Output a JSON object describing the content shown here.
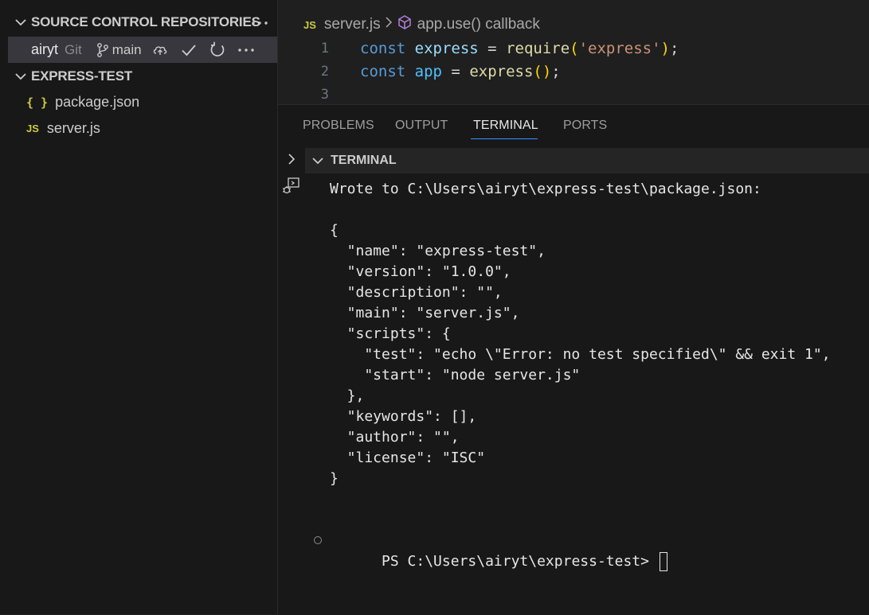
{
  "sidebar": {
    "scm_title": "SOURCE CONTROL REPOSITORIES",
    "repo": {
      "name": "airyt",
      "provider": "Git",
      "branch": "main"
    },
    "folder_title": "EXPRESS-TEST",
    "files": [
      {
        "badge": "{ }",
        "name": "package.json"
      },
      {
        "badge": "JS",
        "name": "server.js"
      }
    ]
  },
  "editor": {
    "breadcrumb": {
      "file_badge": "JS",
      "file": "server.js",
      "symbol": "app.use() callback"
    },
    "lines": [
      {
        "num": "1",
        "tokens": [
          {
            "t": "const",
            "c": "kw"
          },
          {
            "t": " ",
            "c": "op"
          },
          {
            "t": "express",
            "c": "var"
          },
          {
            "t": " = ",
            "c": "op"
          },
          {
            "t": "require",
            "c": "fn"
          },
          {
            "t": "(",
            "c": "paren"
          },
          {
            "t": "'express'",
            "c": "str"
          },
          {
            "t": ")",
            "c": "paren"
          },
          {
            "t": ";",
            "c": "op"
          }
        ]
      },
      {
        "num": "2",
        "tokens": [
          {
            "t": "const",
            "c": "kw"
          },
          {
            "t": " ",
            "c": "op"
          },
          {
            "t": "app",
            "c": "cst"
          },
          {
            "t": " = ",
            "c": "op"
          },
          {
            "t": "express",
            "c": "fn"
          },
          {
            "t": "()",
            "c": "paren"
          },
          {
            "t": ";",
            "c": "op"
          }
        ]
      },
      {
        "num": "3",
        "tokens": []
      }
    ]
  },
  "panel": {
    "tabs": [
      "PROBLEMS",
      "OUTPUT",
      "TERMINAL",
      "PORTS"
    ],
    "active_tab": "TERMINAL",
    "terminal_title": "TERMINAL",
    "output_lines": [
      "Wrote to C:\\Users\\airyt\\express-test\\package.json:",
      "",
      "{",
      "  \"name\": \"express-test\",",
      "  \"version\": \"1.0.0\",",
      "  \"description\": \"\",",
      "  \"main\": \"server.js\",",
      "  \"scripts\": {",
      "    \"test\": \"echo \\\"Error: no test specified\\\" && exit 1\",",
      "    \"start\": \"node server.js\"",
      "  },",
      "  \"keywords\": [],",
      "  \"author\": \"\",",
      "  \"license\": \"ISC\"",
      "}"
    ],
    "prompt": "PS C:\\Users\\airyt\\express-test> "
  },
  "colors": {
    "accent": "#3794ff",
    "js_badge": "#cbcb41"
  },
  "icons": [
    "chevron-down-icon",
    "more-icon",
    "branch-icon",
    "cloud-upload-icon",
    "check-icon",
    "refresh-icon",
    "symbol-method-icon",
    "chevron-right-icon",
    "debug-console-icon"
  ]
}
